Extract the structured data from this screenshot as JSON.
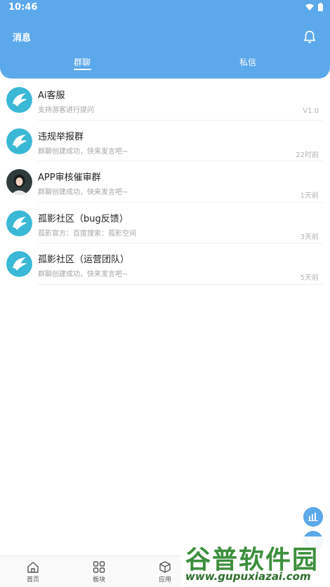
{
  "status": {
    "time": "10:46"
  },
  "header": {
    "title": "消息"
  },
  "tabs": [
    {
      "label": "群聊"
    },
    {
      "label": "私信"
    }
  ],
  "chats": [
    {
      "name": "Ai客服",
      "preview": "支持游客进行提问",
      "time": "V1.0",
      "avatar": "bird-logo"
    },
    {
      "name": "违规举报群",
      "preview": "群聊创建成功，快来发言吧~",
      "time": "22时前",
      "avatar": "bird-logo"
    },
    {
      "name": "APP审核催审群",
      "preview": "群聊创建成功，快来发言吧~",
      "time": "1天前",
      "avatar": "person-photo"
    },
    {
      "name": "孤影社区（bug反馈）",
      "preview": "孤影官方：百度搜索：孤影空间",
      "time": "3天前",
      "avatar": "bird-logo"
    },
    {
      "name": "孤影社区（运营团队）",
      "preview": "群聊创建成功，快来发言吧~",
      "time": "5天前",
      "avatar": "bird-logo"
    }
  ],
  "bottom_nav": [
    {
      "label": "首页",
      "icon": "home-icon"
    },
    {
      "label": "板块",
      "icon": "grid-icon"
    },
    {
      "label": "应用",
      "icon": "cube-icon"
    }
  ],
  "watermark": {
    "big": "谷普软件园",
    "small": "www.gupuxiazai.com"
  },
  "colors": {
    "primary": "#5ba8ea",
    "avatar_teal": "#3ab8d6"
  }
}
